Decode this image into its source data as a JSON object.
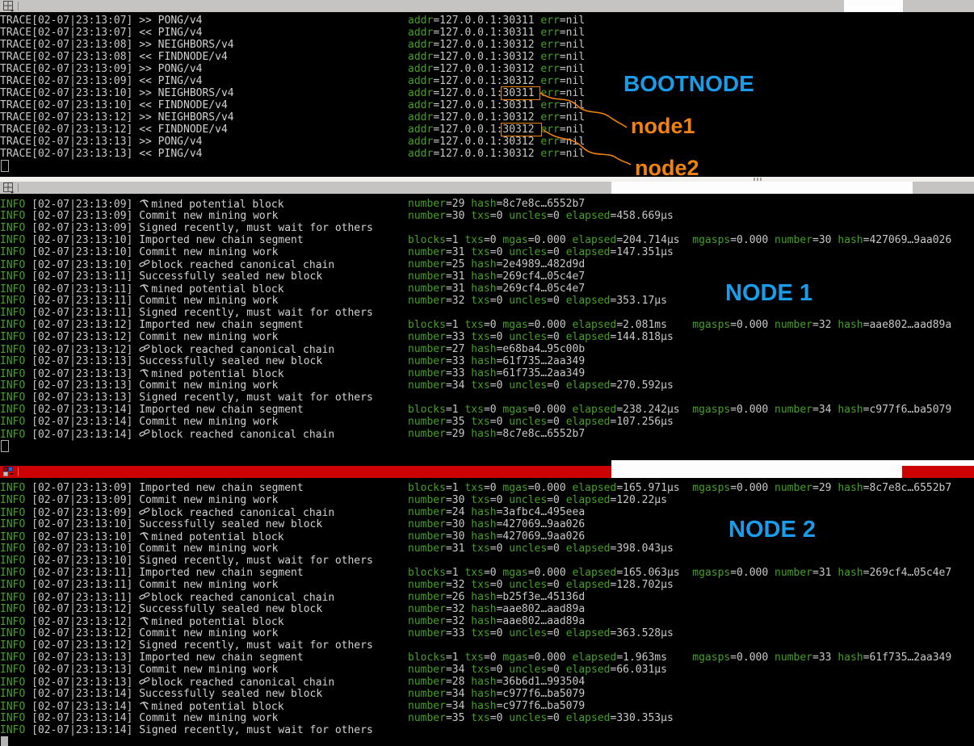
{
  "colors": {
    "terminal_background": "#000000",
    "log_text_gray": "#c8c8c8",
    "info_and_keys_green": "#44a025",
    "annotation_blue": "#1b9ce9",
    "annotation_orange": "#f0820f",
    "titlebar_inactive_gray": "#c6c3c3",
    "titlebar_active_red": "#cc0202"
  },
  "panes": [
    {
      "name": "bootnode",
      "annotation": "BOOTNODE",
      "active": false,
      "port_annotations": [
        {
          "label": "node1",
          "boxed_port": "30311",
          "boxed_line_index": 6
        },
        {
          "label": "node2",
          "boxed_port": "30312",
          "boxed_line_index": 9
        }
      ],
      "lines": [
        {
          "level": "TRACE",
          "time": "[02-07|23:13:07]",
          "msg": ">> PONG/v4",
          "kv": "addr=127.0.0.1:30311 err=nil"
        },
        {
          "level": "TRACE",
          "time": "[02-07|23:13:07]",
          "msg": "<< PING/v4",
          "kv": "addr=127.0.0.1:30311 err=nil"
        },
        {
          "level": "TRACE",
          "time": "[02-07|23:13:08]",
          "msg": ">> NEIGHBORS/v4",
          "kv": "addr=127.0.0.1:30312 err=nil"
        },
        {
          "level": "TRACE",
          "time": "[02-07|23:13:08]",
          "msg": "<< FINDNODE/v4",
          "kv": "addr=127.0.0.1:30312 err=nil"
        },
        {
          "level": "TRACE",
          "time": "[02-07|23:13:09]",
          "msg": ">> PONG/v4",
          "kv": "addr=127.0.0.1:30312 err=nil"
        },
        {
          "level": "TRACE",
          "time": "[02-07|23:13:09]",
          "msg": "<< PING/v4",
          "kv": "addr=127.0.0.1:30312 err=nil"
        },
        {
          "level": "TRACE",
          "time": "[02-07|23:13:10]",
          "msg": ">> NEIGHBORS/v4",
          "kv": "addr=127.0.0.1:30311 err=nil"
        },
        {
          "level": "TRACE",
          "time": "[02-07|23:13:10]",
          "msg": "<< FINDNODE/v4",
          "kv": "addr=127.0.0.1:30311 err=nil"
        },
        {
          "level": "TRACE",
          "time": "[02-07|23:13:12]",
          "msg": ">> NEIGHBORS/v4",
          "kv": "addr=127.0.0.1:30312 err=nil"
        },
        {
          "level": "TRACE",
          "time": "[02-07|23:13:12]",
          "msg": "<< FINDNODE/v4",
          "kv": "addr=127.0.0.1:30312 err=nil"
        },
        {
          "level": "TRACE",
          "time": "[02-07|23:13:13]",
          "msg": ">> PONG/v4",
          "kv": "addr=127.0.0.1:30312 err=nil"
        },
        {
          "level": "TRACE",
          "time": "[02-07|23:13:13]",
          "msg": "<< PING/v4",
          "kv": "addr=127.0.0.1:30312 err=nil"
        }
      ]
    },
    {
      "name": "node1",
      "annotation": "NODE 1",
      "active": false,
      "lines": [
        {
          "level": "INFO",
          "time": "[02-07|23:13:09]",
          "icon": "pickaxe",
          "msg": "mined potential block",
          "kv": "number=29 hash=8c7e8c…6552b7"
        },
        {
          "level": "INFO",
          "time": "[02-07|23:13:09]",
          "msg": "Commit new mining work",
          "kv": "number=30 txs=0 uncles=0 elapsed=458.669µs"
        },
        {
          "level": "INFO",
          "time": "[02-07|23:13:09]",
          "msg": "Signed recently, must wait for others",
          "kv": ""
        },
        {
          "level": "INFO",
          "time": "[02-07|23:13:10]",
          "msg": "Imported new chain segment",
          "kv": "blocks=1 txs=0 mgas=0.000 elapsed=204.714µs  mgasps=0.000 number=30 hash=427069…9aa026"
        },
        {
          "level": "INFO",
          "time": "[02-07|23:13:10]",
          "msg": "Commit new mining work",
          "kv": "number=31 txs=0 uncles=0 elapsed=147.351µs"
        },
        {
          "level": "INFO",
          "time": "[02-07|23:13:10]",
          "icon": "chain-link",
          "msg": "block reached canonical chain",
          "kv": "number=25 hash=2e4989…482d9d"
        },
        {
          "level": "INFO",
          "time": "[02-07|23:13:11]",
          "msg": "Successfully sealed new block",
          "kv": "number=31 hash=269cf4…05c4e7"
        },
        {
          "level": "INFO",
          "time": "[02-07|23:13:11]",
          "icon": "pickaxe",
          "msg": "mined potential block",
          "kv": "number=31 hash=269cf4…05c4e7"
        },
        {
          "level": "INFO",
          "time": "[02-07|23:13:11]",
          "msg": "Commit new mining work",
          "kv": "number=32 txs=0 uncles=0 elapsed=353.17µs"
        },
        {
          "level": "INFO",
          "time": "[02-07|23:13:11]",
          "msg": "Signed recently, must wait for others",
          "kv": ""
        },
        {
          "level": "INFO",
          "time": "[02-07|23:13:12]",
          "msg": "Imported new chain segment",
          "kv": "blocks=1 txs=0 mgas=0.000 elapsed=2.081ms    mgasps=0.000 number=32 hash=aae802…aad89a"
        },
        {
          "level": "INFO",
          "time": "[02-07|23:13:12]",
          "msg": "Commit new mining work",
          "kv": "number=33 txs=0 uncles=0 elapsed=144.818µs"
        },
        {
          "level": "INFO",
          "time": "[02-07|23:13:12]",
          "icon": "chain-link",
          "msg": "block reached canonical chain",
          "kv": "number=27 hash=e68ba4…95c00b"
        },
        {
          "level": "INFO",
          "time": "[02-07|23:13:13]",
          "msg": "Successfully sealed new block",
          "kv": "number=33 hash=61f735…2aa349"
        },
        {
          "level": "INFO",
          "time": "[02-07|23:13:13]",
          "icon": "pickaxe",
          "msg": "mined potential block",
          "kv": "number=33 hash=61f735…2aa349"
        },
        {
          "level": "INFO",
          "time": "[02-07|23:13:13]",
          "msg": "Commit new mining work",
          "kv": "number=34 txs=0 uncles=0 elapsed=270.592µs"
        },
        {
          "level": "INFO",
          "time": "[02-07|23:13:13]",
          "msg": "Signed recently, must wait for others",
          "kv": ""
        },
        {
          "level": "INFO",
          "time": "[02-07|23:13:14]",
          "msg": "Imported new chain segment",
          "kv": "blocks=1 txs=0 mgas=0.000 elapsed=238.242µs  mgasps=0.000 number=34 hash=c977f6…ba5079"
        },
        {
          "level": "INFO",
          "time": "[02-07|23:13:14]",
          "msg": "Commit new mining work",
          "kv": "number=35 txs=0 uncles=0 elapsed=107.256µs"
        },
        {
          "level": "INFO",
          "time": "[02-07|23:13:14]",
          "icon": "chain-link",
          "msg": "block reached canonical chain",
          "kv": "number=29 hash=8c7e8c…6552b7"
        }
      ]
    },
    {
      "name": "node2",
      "annotation": "NODE 2",
      "active": true,
      "lines": [
        {
          "level": "INFO",
          "time": "[02-07|23:13:09]",
          "msg": "Imported new chain segment",
          "kv": "blocks=1 txs=0 mgas=0.000 elapsed=165.971µs  mgasps=0.000 number=29 hash=8c7e8c…6552b7"
        },
        {
          "level": "INFO",
          "time": "[02-07|23:13:09]",
          "msg": "Commit new mining work",
          "kv": "number=30 txs=0 uncles=0 elapsed=120.22µs"
        },
        {
          "level": "INFO",
          "time": "[02-07|23:13:09]",
          "icon": "chain-link",
          "msg": "block reached canonical chain",
          "kv": "number=24 hash=3afbc4…495eea"
        },
        {
          "level": "INFO",
          "time": "[02-07|23:13:10]",
          "msg": "Successfully sealed new block",
          "kv": "number=30 hash=427069…9aa026"
        },
        {
          "level": "INFO",
          "time": "[02-07|23:13:10]",
          "icon": "pickaxe",
          "msg": "mined potential block",
          "kv": "number=30 hash=427069…9aa026"
        },
        {
          "level": "INFO",
          "time": "[02-07|23:13:10]",
          "msg": "Commit new mining work",
          "kv": "number=31 txs=0 uncles=0 elapsed=398.043µs"
        },
        {
          "level": "INFO",
          "time": "[02-07|23:13:10]",
          "msg": "Signed recently, must wait for others",
          "kv": ""
        },
        {
          "level": "INFO",
          "time": "[02-07|23:13:11]",
          "msg": "Imported new chain segment",
          "kv": "blocks=1 txs=0 mgas=0.000 elapsed=165.063µs  mgasps=0.000 number=31 hash=269cf4…05c4e7"
        },
        {
          "level": "INFO",
          "time": "[02-07|23:13:11]",
          "msg": "Commit new mining work",
          "kv": "number=32 txs=0 uncles=0 elapsed=128.702µs"
        },
        {
          "level": "INFO",
          "time": "[02-07|23:13:11]",
          "icon": "chain-link",
          "msg": "block reached canonical chain",
          "kv": "number=26 hash=b25f3e…45136d"
        },
        {
          "level": "INFO",
          "time": "[02-07|23:13:12]",
          "msg": "Successfully sealed new block",
          "kv": "number=32 hash=aae802…aad89a"
        },
        {
          "level": "INFO",
          "time": "[02-07|23:13:12]",
          "icon": "pickaxe",
          "msg": "mined potential block",
          "kv": "number=32 hash=aae802…aad89a"
        },
        {
          "level": "INFO",
          "time": "[02-07|23:13:12]",
          "msg": "Commit new mining work",
          "kv": "number=33 txs=0 uncles=0 elapsed=363.528µs"
        },
        {
          "level": "INFO",
          "time": "[02-07|23:13:12]",
          "msg": "Signed recently, must wait for others",
          "kv": ""
        },
        {
          "level": "INFO",
          "time": "[02-07|23:13:13]",
          "msg": "Imported new chain segment",
          "kv": "blocks=1 txs=0 mgas=0.000 elapsed=1.963ms    mgasps=0.000 number=33 hash=61f735…2aa349"
        },
        {
          "level": "INFO",
          "time": "[02-07|23:13:13]",
          "msg": "Commit new mining work",
          "kv": "number=34 txs=0 uncles=0 elapsed=66.031µs"
        },
        {
          "level": "INFO",
          "time": "[02-07|23:13:13]",
          "icon": "chain-link",
          "msg": "block reached canonical chain",
          "kv": "number=28 hash=36b6d1…993504"
        },
        {
          "level": "INFO",
          "time": "[02-07|23:13:14]",
          "msg": "Successfully sealed new block",
          "kv": "number=34 hash=c977f6…ba5079"
        },
        {
          "level": "INFO",
          "time": "[02-07|23:13:14]",
          "icon": "pickaxe",
          "msg": "mined potential block",
          "kv": "number=34 hash=c977f6…ba5079"
        },
        {
          "level": "INFO",
          "time": "[02-07|23:13:14]",
          "msg": "Commit new mining work",
          "kv": "number=35 txs=0 uncles=0 elapsed=330.353µs"
        },
        {
          "level": "INFO",
          "time": "[02-07|23:13:14]",
          "msg": "Signed recently, must wait for others",
          "kv": ""
        }
      ]
    }
  ]
}
